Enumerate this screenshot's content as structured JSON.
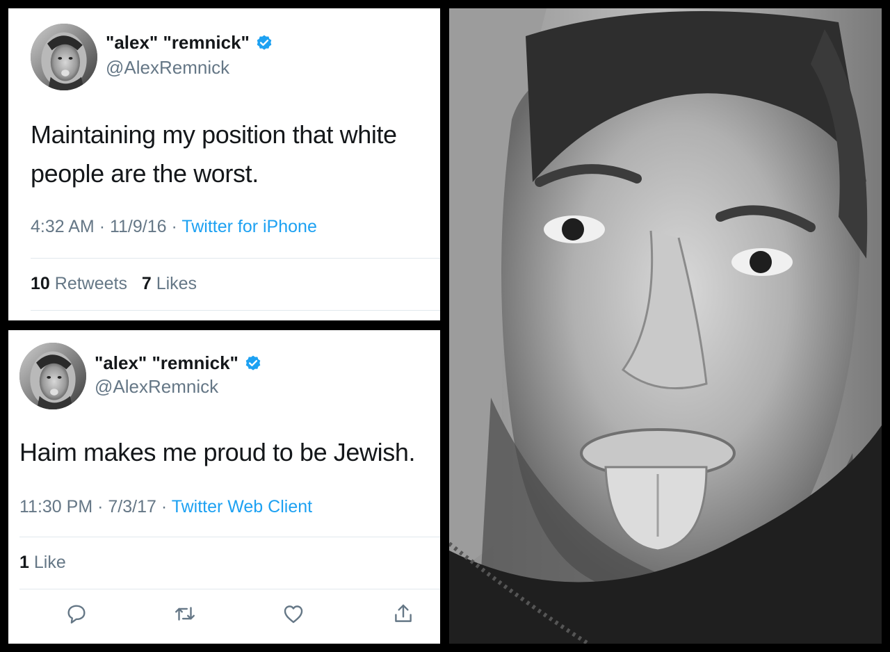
{
  "tweets": [
    {
      "display_name": "\"alex\" \"remnick\"",
      "handle": "@AlexRemnick",
      "text": "Maintaining my position that white people are the worst.",
      "time": "4:32 AM",
      "date": "11/9/16",
      "source": "Twitter for iPhone",
      "retweets_count": "10",
      "retweets_label": "Retweets",
      "likes_count": "7",
      "likes_label": "Likes"
    },
    {
      "display_name": "\"alex\" \"remnick\"",
      "handle": "@AlexRemnick",
      "text": "Haim makes me proud to be Jewish.",
      "time": "11:30 PM",
      "date": "7/3/17",
      "source": "Twitter Web Client",
      "likes_count": "1",
      "likes_label": "Like"
    }
  ],
  "separator": "·",
  "actions": [
    "reply-icon",
    "retweet-icon",
    "like-icon",
    "share-icon"
  ],
  "colors": {
    "verified": "#1da1f2",
    "link": "#1da1f2",
    "secondary_text": "#657786",
    "primary_text": "#14171a",
    "divider": "#e1e8ed"
  }
}
